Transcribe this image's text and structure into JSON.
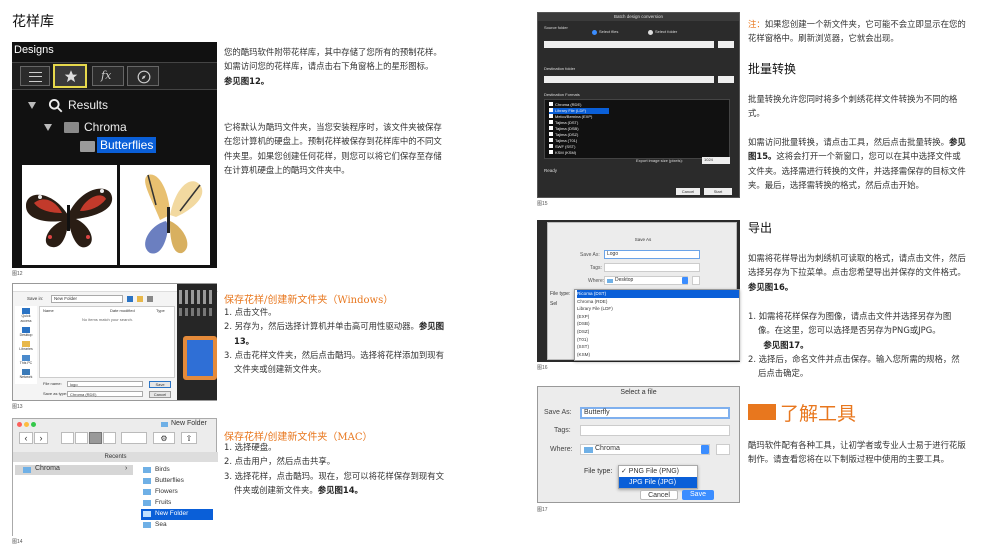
{
  "page_title": "花样库",
  "fig12": {
    "header": "Designs",
    "tree": {
      "results": "Results",
      "chroma": "Chroma",
      "butterflies": "Butterflies"
    },
    "fx_label": "fx",
    "caption": "图12"
  },
  "intro": {
    "p1": "您的酷玛软件附带花样库，其中存储了您所有的预制花样。如需访问您的花样库，请点击右下角窗格上的星形图标。",
    "p1_ref": "参见图12。",
    "p2": "它将默认为酷玛文件夹，当您安装程序时，该文件夹被保存在您计算机的硬盘上。预制花样被保存到花样库中的不同文件夹里。如果您创建任何花样，则您可以将它们保存至存储在计算机硬盘上的酷玛文件夹中。"
  },
  "fig13": {
    "save_in_label": "Save in:",
    "save_in_value": "New Folder",
    "col_name": "Name",
    "col_date": "Date modified",
    "col_type": "Type",
    "empty_msg": "No items match your search.",
    "places": [
      "Quick access",
      "Desktop",
      "Libraries",
      "This PC",
      "Network"
    ],
    "file_name_label": "File name:",
    "file_name_value": "logo",
    "save_as_label": "Save as type:",
    "save_as_value": "Chroma (RDE)",
    "save_btn": "Save",
    "cancel_btn": "Cancel",
    "caption": "图13"
  },
  "win_section": {
    "title": "保存花样/创建新文件夹（Windows）",
    "steps": [
      "1. 点击文件。",
      "2. 另存为，然后选择计算机并单击高可用性驱动器。",
      "3. 点击花样文件夹，然后点击酷玛。选择将花样添加到现有文件夹或创建新文件夹。"
    ],
    "step2_ref": "参见图13。"
  },
  "fig14": {
    "folder_title": "New Folder",
    "recents": "Recents",
    "chroma": "Chroma",
    "folders": [
      "Birds",
      "Butterflies",
      "Flowers",
      "Fruits",
      "New Folder",
      "Sea"
    ],
    "caption": "图14"
  },
  "mac_section": {
    "title": "保存花样/创建新文件夹（MAC）",
    "steps": [
      "1. 选择硬盘。",
      "2. 点击用户，然后点击共享。",
      "3. 选择花样，点击酷玛。现在，您可以将花样保存到现有文件夹或创建新文件夹。"
    ],
    "step3_ref": "参见图14。"
  },
  "fig15": {
    "window_title": "Batch design conversion",
    "source_label": "Source folder",
    "radio1": "Select files",
    "radio2": "Select folder",
    "dest_label": "Destination folder",
    "formats_label": "Destination Formats",
    "formats": [
      "Chroma (RDE)",
      "Library File (LDF)",
      "Melco/Bernina (EXP)",
      "Tajima (DST)",
      "Tajima (DSB)",
      "Tajima (DSZ)",
      "Tajima (T01)",
      "SWF (SST)",
      "KSM (KSM)"
    ],
    "export_label": "Export image size (pixels):",
    "export_value": "1024",
    "ready": "Ready",
    "cancel": "Cancel",
    "start": "Start",
    "caption": "图15"
  },
  "fig16": {
    "window_title": "Save As",
    "save_as_label": "Save As:",
    "save_as_value": "Logo",
    "tags_label": "Tags:",
    "where_label": "Where:",
    "where_value": "Desktop",
    "file_type_label": "File type:",
    "options": [
      "Ricoma (DST)",
      "Chroma (RDE)",
      "Library File (LDF)",
      "(EXP)",
      "(DSB)",
      "(DSZ)",
      "(T01)",
      "(SST)",
      "(KSM)"
    ],
    "sel_partial": "Sel",
    "caption": "图16"
  },
  "fig17": {
    "window_title": "Select a file",
    "save_as_label": "Save As:",
    "save_as_value": "Butterfly",
    "tags_label": "Tags:",
    "where_label": "Where:",
    "where_value": "Chroma",
    "file_type_label": "File type:",
    "opt1": "✓ PNG File (PNG)",
    "opt2": "JPG File (JPG)",
    "cancel": "Cancel",
    "save": "Save",
    "caption": "图17"
  },
  "note": {
    "label": "注：",
    "text": "如果您创建一个新文件夹，它可能不会立即显示在您的花样窗格中。刷新浏览器，它就会出现。"
  },
  "batch": {
    "title": "批量转换",
    "p1": "批量转换允许您同时将多个刺绣花样文件转换为不同的格式。",
    "p2a": "如需访问批量转换，请点击工具，然后点击批量转换。",
    "p2_ref": "参见图15。",
    "p2b": "这将会打开一个新窗口，您可以在其中选择文件或文件夹。选择需进行转换的文件，并选择需保存的目标文件夹。最后，选择需转换的格式，然后点击开始。"
  },
  "export": {
    "title": "导出",
    "p1": "如需将花样导出为刺绣机可读取的格式，请点击文件，然后选择另存为下拉菜单。点击您希望导出并保存的文件格式。",
    "p1_ref": "参见图16。",
    "s1": "1. 如需将花样保存为图像，请点击文件并选择另存为图像。在这里，您可以选择是否另存为PNG或JPG。",
    "s1_ref": "参见图17。",
    "s2": "2. 选择后，命名文件并点击保存。输入您所需的规格，然后点击确定。"
  },
  "tools": {
    "title": "了解工具",
    "p": "酷玛软件配有各种工具，让初学者或专业人士易于进行花版制作。请查看您将在以下制版过程中使用的主要工具。"
  },
  "colors": {
    "accent": "#e8771e",
    "selection": "#0a5fd8"
  }
}
